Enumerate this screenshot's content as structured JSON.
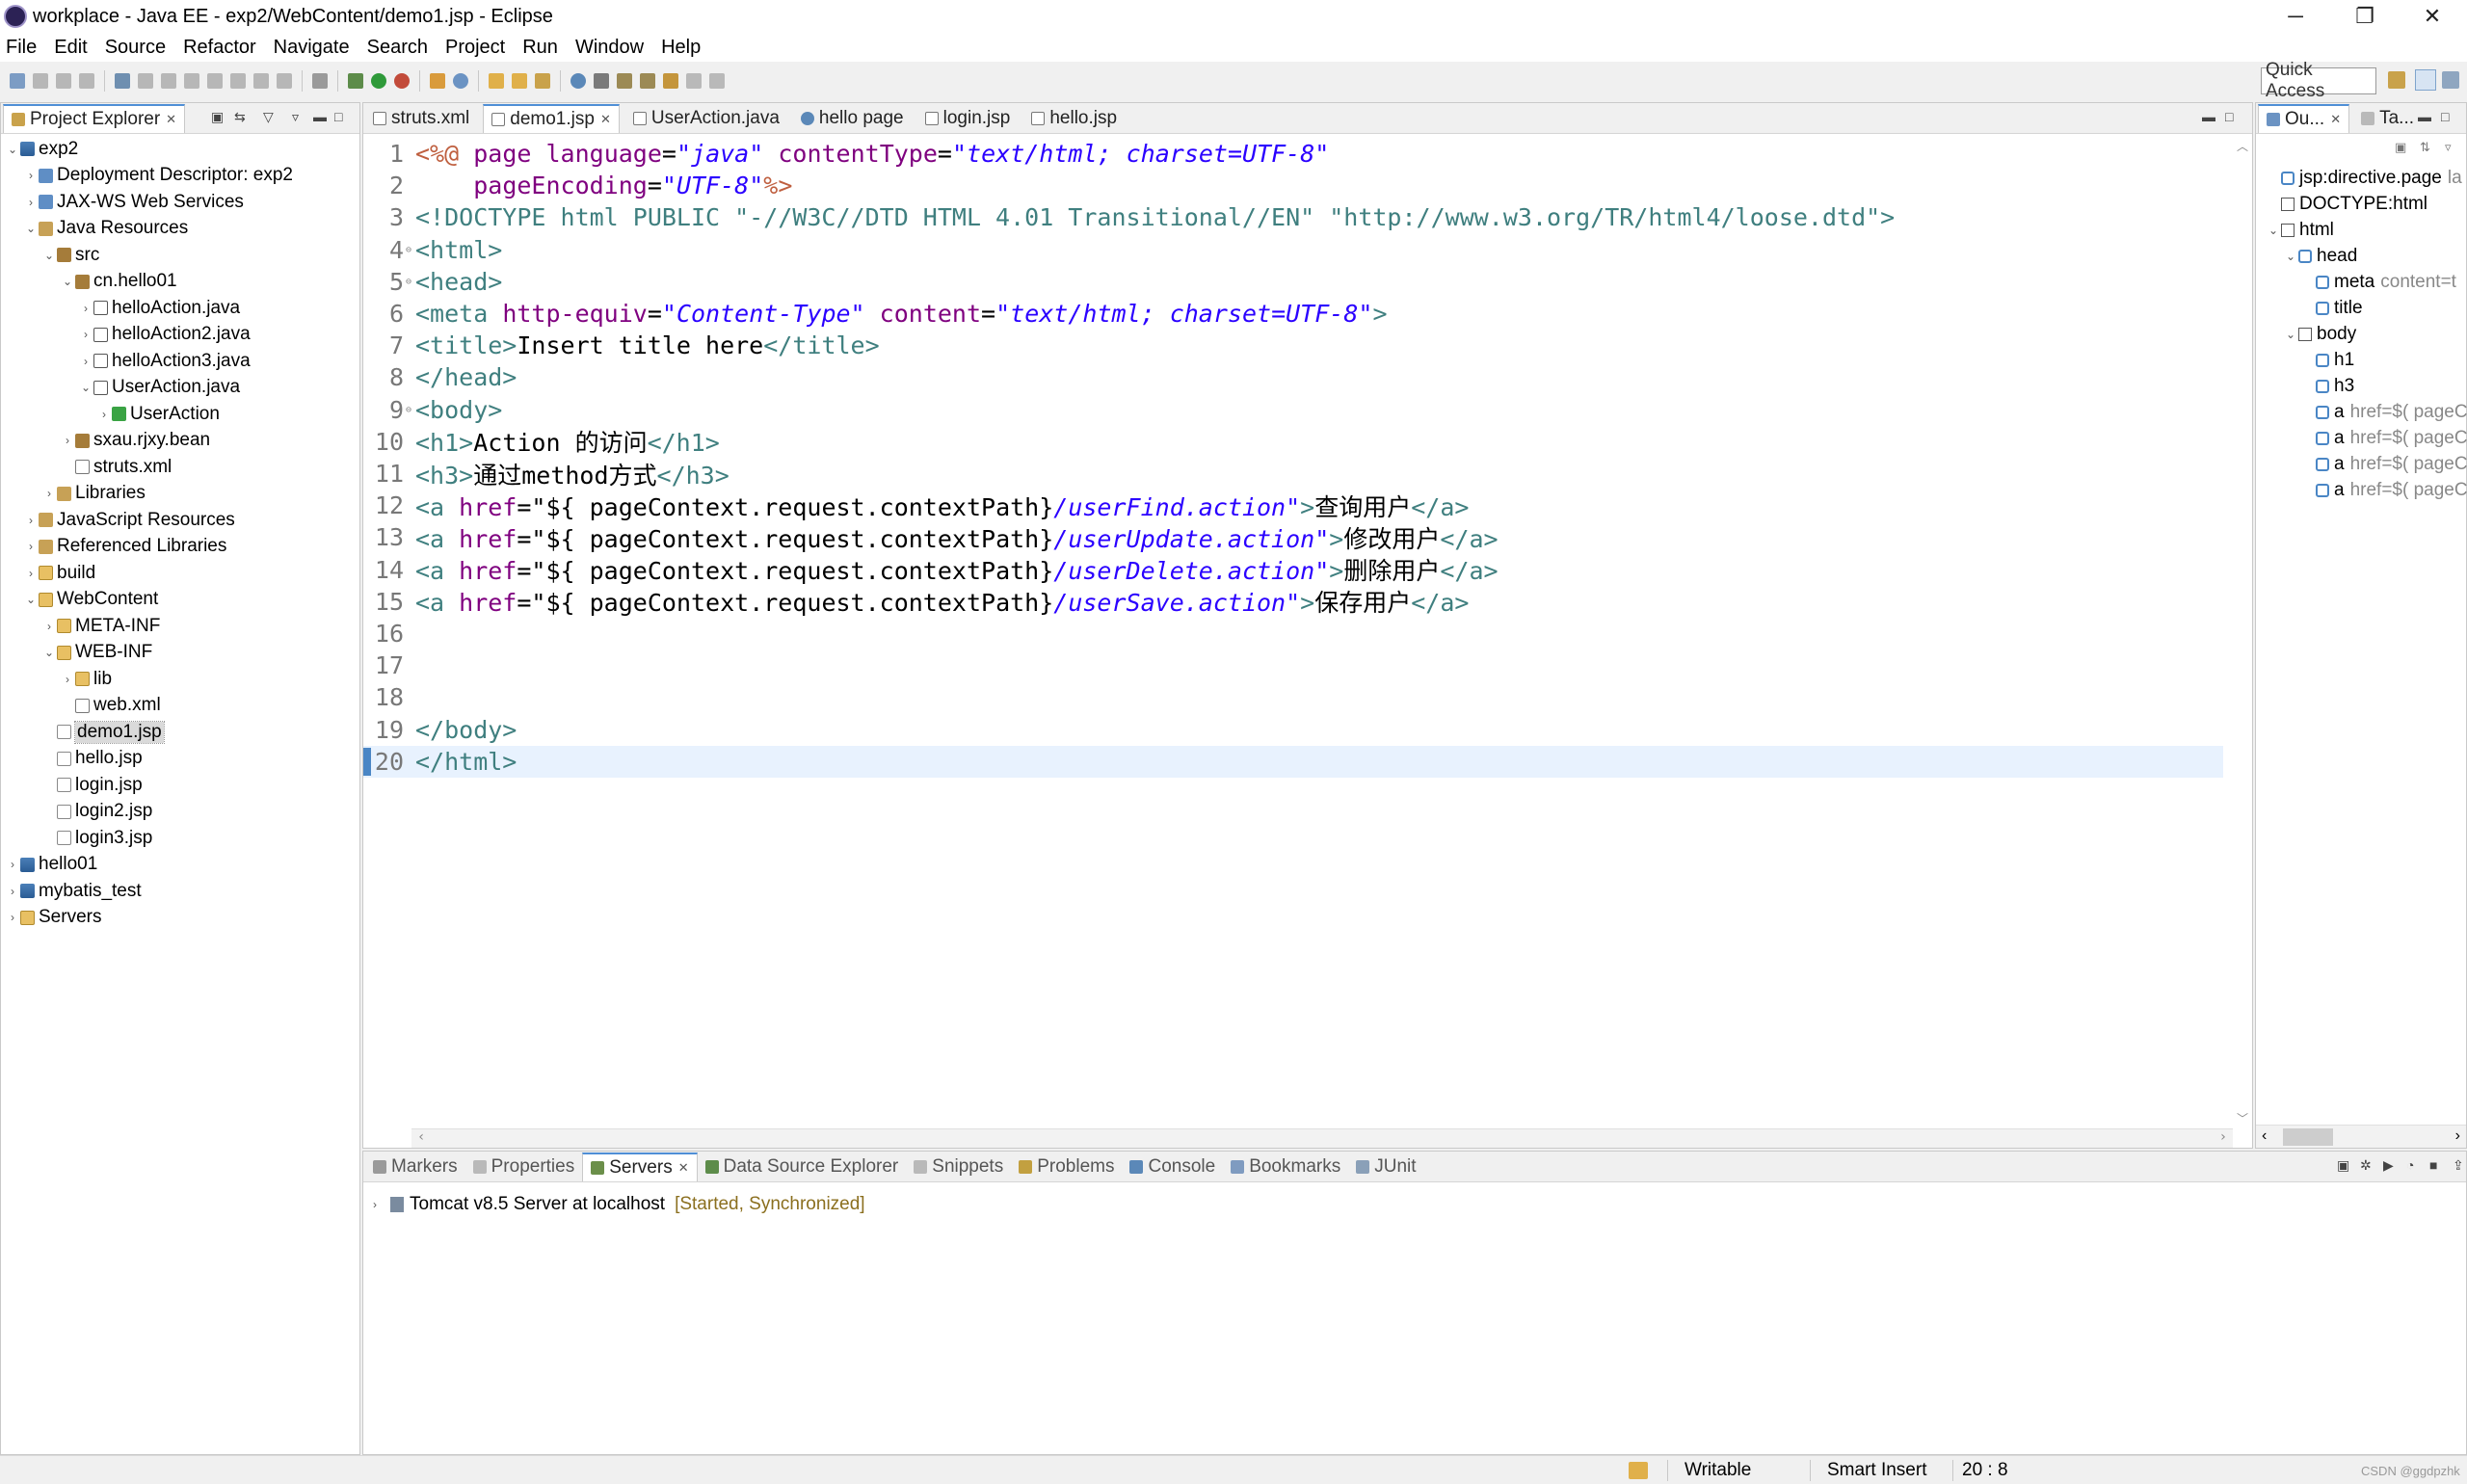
{
  "window": {
    "title": "workplace - Java EE - exp2/WebContent/demo1.jsp - Eclipse",
    "minimize": "─",
    "maximize": "❐",
    "close": "✕"
  },
  "menu": [
    "File",
    "Edit",
    "Source",
    "Refactor",
    "Navigate",
    "Search",
    "Project",
    "Run",
    "Window",
    "Help"
  ],
  "toolbar": {
    "quick_access_placeholder": "Quick Access"
  },
  "project_explorer": {
    "title": "Project Explorer",
    "items": [
      {
        "label": "exp2",
        "depth": 0,
        "expanded": true,
        "icon": "project-icon"
      },
      {
        "label": "Deployment Descriptor: exp2",
        "depth": 1,
        "expanded": false,
        "icon": "descriptor-icon"
      },
      {
        "label": "JAX-WS Web Services",
        "depth": 1,
        "expanded": false,
        "icon": "webservice-icon"
      },
      {
        "label": "Java Resources",
        "depth": 1,
        "expanded": true,
        "icon": "java-resources-icon"
      },
      {
        "label": "src",
        "depth": 2,
        "expanded": true,
        "icon": "source-folder-icon"
      },
      {
        "label": "cn.hello01",
        "depth": 3,
        "expanded": true,
        "icon": "package-icon"
      },
      {
        "label": "helloAction.java",
        "depth": 4,
        "expanded": false,
        "icon": "java-file-icon"
      },
      {
        "label": "helloAction2.java",
        "depth": 4,
        "expanded": false,
        "icon": "java-file-icon"
      },
      {
        "label": "helloAction3.java",
        "depth": 4,
        "expanded": false,
        "icon": "java-file-icon"
      },
      {
        "label": "UserAction.java",
        "depth": 4,
        "expanded": true,
        "icon": "java-file-icon"
      },
      {
        "label": "UserAction",
        "depth": 5,
        "expanded": false,
        "icon": "class-icon"
      },
      {
        "label": "sxau.rjxy.bean",
        "depth": 3,
        "expanded": false,
        "icon": "package-icon"
      },
      {
        "label": "struts.xml",
        "depth": 3,
        "expanded": null,
        "icon": "xml-file-icon"
      },
      {
        "label": "Libraries",
        "depth": 2,
        "expanded": false,
        "icon": "library-icon"
      },
      {
        "label": "JavaScript Resources",
        "depth": 1,
        "expanded": false,
        "icon": "js-resources-icon"
      },
      {
        "label": "Referenced Libraries",
        "depth": 1,
        "expanded": false,
        "icon": "library-icon"
      },
      {
        "label": "build",
        "depth": 1,
        "expanded": false,
        "icon": "folder-icon"
      },
      {
        "label": "WebContent",
        "depth": 1,
        "expanded": true,
        "icon": "folder-icon"
      },
      {
        "label": "META-INF",
        "depth": 2,
        "expanded": false,
        "icon": "folder-icon"
      },
      {
        "label": "WEB-INF",
        "depth": 2,
        "expanded": true,
        "icon": "folder-icon"
      },
      {
        "label": "lib",
        "depth": 3,
        "expanded": false,
        "icon": "folder-icon"
      },
      {
        "label": "web.xml",
        "depth": 3,
        "expanded": null,
        "icon": "xml-file-icon"
      },
      {
        "label": "demo1.jsp",
        "depth": 2,
        "expanded": null,
        "icon": "jsp-file-icon",
        "selected": true
      },
      {
        "label": "hello.jsp",
        "depth": 2,
        "expanded": null,
        "icon": "jsp-file-icon"
      },
      {
        "label": "login.jsp",
        "depth": 2,
        "expanded": null,
        "icon": "jsp-file-icon"
      },
      {
        "label": "login2.jsp",
        "depth": 2,
        "expanded": null,
        "icon": "jsp-file-icon"
      },
      {
        "label": "login3.jsp",
        "depth": 2,
        "expanded": null,
        "icon": "jsp-file-icon"
      },
      {
        "label": "hello01",
        "depth": 0,
        "expanded": false,
        "icon": "project-icon"
      },
      {
        "label": "mybatis_test",
        "depth": 0,
        "expanded": false,
        "icon": "project-icon"
      },
      {
        "label": "Servers",
        "depth": 0,
        "expanded": false,
        "icon": "servers-folder-icon"
      }
    ]
  },
  "editor": {
    "tabs": [
      {
        "label": "struts.xml",
        "active": false,
        "icon": "xml-file-icon"
      },
      {
        "label": "demo1.jsp",
        "active": true,
        "icon": "jsp-file-icon"
      },
      {
        "label": "UserAction.java",
        "active": false,
        "icon": "java-file-icon"
      },
      {
        "label": "hello page",
        "active": false,
        "icon": "browser-icon"
      },
      {
        "label": "login.jsp",
        "active": false,
        "icon": "jsp-file-icon"
      },
      {
        "label": "hello.jsp",
        "active": false,
        "icon": "jsp-file-icon"
      }
    ],
    "lines": [
      {
        "n": "1",
        "fold": "",
        "segments": [
          [
            "dir",
            "<%@ "
          ],
          [
            "attr",
            "page "
          ],
          [
            "attr",
            "language"
          ],
          [
            "text",
            "="
          ],
          [
            "str",
            "\"java\""
          ],
          [
            "text",
            " "
          ],
          [
            "attr",
            "contentType"
          ],
          [
            "text",
            "="
          ],
          [
            "str",
            "\"text/html; charset=UTF-8\""
          ]
        ]
      },
      {
        "n": "2",
        "fold": "",
        "segments": [
          [
            "text",
            "    "
          ],
          [
            "attr",
            "pageEncoding"
          ],
          [
            "text",
            "="
          ],
          [
            "str",
            "\"UTF-8\""
          ],
          [
            "dir",
            "%>"
          ]
        ]
      },
      {
        "n": "3",
        "fold": "",
        "segments": [
          [
            "doc",
            "<!DOCTYPE html PUBLIC \"-//W3C//DTD HTML 4.01 Transitional//EN\" \"http://www.w3.org/TR/html4/loose.dtd\">"
          ]
        ]
      },
      {
        "n": "4",
        "fold": "⊖",
        "segments": [
          [
            "tag",
            "<html>"
          ]
        ]
      },
      {
        "n": "5",
        "fold": "⊖",
        "segments": [
          [
            "tag",
            "<head>"
          ]
        ]
      },
      {
        "n": "6",
        "fold": "",
        "segments": [
          [
            "tag",
            "<meta "
          ],
          [
            "attr",
            "http-equiv"
          ],
          [
            "text",
            "="
          ],
          [
            "str",
            "\"Content-Type\""
          ],
          [
            "text",
            " "
          ],
          [
            "attr",
            "content"
          ],
          [
            "text",
            "="
          ],
          [
            "str",
            "\"text/html; charset=UTF-8\""
          ],
          [
            "tag",
            ">"
          ]
        ]
      },
      {
        "n": "7",
        "fold": "",
        "segments": [
          [
            "tag",
            "<title>"
          ],
          [
            "text",
            "Insert title here"
          ],
          [
            "tag",
            "</title>"
          ]
        ]
      },
      {
        "n": "8",
        "fold": "",
        "segments": [
          [
            "tag",
            "</head>"
          ]
        ]
      },
      {
        "n": "9",
        "fold": "⊖",
        "segments": [
          [
            "tag",
            "<body>"
          ]
        ]
      },
      {
        "n": "10",
        "fold": "",
        "segments": [
          [
            "tag",
            "<h1>"
          ],
          [
            "text",
            "Action 的访问"
          ],
          [
            "tag",
            "</h1>"
          ]
        ]
      },
      {
        "n": "11",
        "fold": "",
        "segments": [
          [
            "tag",
            "<h3>"
          ],
          [
            "text",
            "通过method方式"
          ],
          [
            "tag",
            "</h3>"
          ]
        ]
      },
      {
        "n": "12",
        "fold": "",
        "segments": [
          [
            "tag",
            "<a "
          ],
          [
            "attr",
            "href"
          ],
          [
            "text",
            "=\"${ pageContext.request.contextPath}"
          ],
          [
            "str",
            "/userFind.action\""
          ],
          [
            "tag",
            ">"
          ],
          [
            "text",
            "查询用户"
          ],
          [
            "tag",
            "</a>"
          ]
        ]
      },
      {
        "n": "13",
        "fold": "",
        "segments": [
          [
            "tag",
            "<a "
          ],
          [
            "attr",
            "href"
          ],
          [
            "text",
            "=\"${ pageContext.request.contextPath}"
          ],
          [
            "str",
            "/userUpdate.action\""
          ],
          [
            "tag",
            ">"
          ],
          [
            "text",
            "修改用户"
          ],
          [
            "tag",
            "</a>"
          ]
        ]
      },
      {
        "n": "14",
        "fold": "",
        "segments": [
          [
            "tag",
            "<a "
          ],
          [
            "attr",
            "href"
          ],
          [
            "text",
            "=\"${ pageContext.request.contextPath}"
          ],
          [
            "str",
            "/userDelete.action\""
          ],
          [
            "tag",
            ">"
          ],
          [
            "text",
            "删除用户"
          ],
          [
            "tag",
            "</a>"
          ]
        ]
      },
      {
        "n": "15",
        "fold": "",
        "segments": [
          [
            "tag",
            "<a "
          ],
          [
            "attr",
            "href"
          ],
          [
            "text",
            "=\"${ pageContext.request.contextPath}"
          ],
          [
            "str",
            "/userSave.action\""
          ],
          [
            "tag",
            ">"
          ],
          [
            "text",
            "保存用户"
          ],
          [
            "tag",
            "</a>"
          ]
        ]
      },
      {
        "n": "16",
        "fold": "",
        "segments": []
      },
      {
        "n": "17",
        "fold": "",
        "segments": []
      },
      {
        "n": "18",
        "fold": "",
        "segments": []
      },
      {
        "n": "19",
        "fold": "",
        "segments": [
          [
            "tag",
            "</body>"
          ]
        ]
      },
      {
        "n": "20",
        "fold": "",
        "current": true,
        "segments": [
          [
            "tag",
            "</html>"
          ]
        ]
      }
    ]
  },
  "outline": {
    "tabs": [
      {
        "label": "Ou...",
        "active": true
      },
      {
        "label": "Ta...",
        "active": false
      }
    ],
    "items": [
      {
        "label": "jsp:directive.page",
        "extra": "la",
        "depth": 0,
        "arrow": "",
        "icon": "tag-icon"
      },
      {
        "label": "DOCTYPE:html",
        "extra": "",
        "depth": 0,
        "arrow": "",
        "icon": "doctype-icon"
      },
      {
        "label": "html",
        "extra": "",
        "depth": 0,
        "arrow": "v",
        "icon": "doctype-icon"
      },
      {
        "label": "head",
        "extra": "",
        "depth": 1,
        "arrow": "v",
        "icon": "tag-icon"
      },
      {
        "label": "meta",
        "extra": "content=t",
        "depth": 2,
        "arrow": "",
        "icon": "tag-icon"
      },
      {
        "label": "title",
        "extra": "",
        "depth": 2,
        "arrow": "",
        "icon": "title-icon"
      },
      {
        "label": "body",
        "extra": "",
        "depth": 1,
        "arrow": "v",
        "icon": "body-icon"
      },
      {
        "label": "h1",
        "extra": "",
        "depth": 2,
        "arrow": "",
        "icon": "tag-icon"
      },
      {
        "label": "h3",
        "extra": "",
        "depth": 2,
        "arrow": "",
        "icon": "tag-icon"
      },
      {
        "label": "a",
        "extra": "href=$( pageC",
        "depth": 2,
        "arrow": "",
        "icon": "anchor-icon"
      },
      {
        "label": "a",
        "extra": "href=$( pageC",
        "depth": 2,
        "arrow": "",
        "icon": "anchor-icon"
      },
      {
        "label": "a",
        "extra": "href=$( pageC",
        "depth": 2,
        "arrow": "",
        "icon": "anchor-icon"
      },
      {
        "label": "a",
        "extra": "href=$( pageC",
        "depth": 2,
        "arrow": "",
        "icon": "anchor-icon"
      }
    ]
  },
  "bottom_panel": {
    "tabs": [
      {
        "label": "Markers",
        "active": false
      },
      {
        "label": "Properties",
        "active": false
      },
      {
        "label": "Servers",
        "active": true
      },
      {
        "label": "Data Source Explorer",
        "active": false
      },
      {
        "label": "Snippets",
        "active": false
      },
      {
        "label": "Problems",
        "active": false
      },
      {
        "label": "Console",
        "active": false
      },
      {
        "label": "Bookmarks",
        "active": false
      },
      {
        "label": "JUnit",
        "active": false
      }
    ],
    "server": {
      "name": "Tomcat v8.5 Server at localhost",
      "status": "[Started, Synchronized]"
    }
  },
  "statusbar": {
    "writable": "Writable",
    "insert_mode": "Smart Insert",
    "position": "20 : 8",
    "watermark": "CSDN @ggdpzhk"
  }
}
